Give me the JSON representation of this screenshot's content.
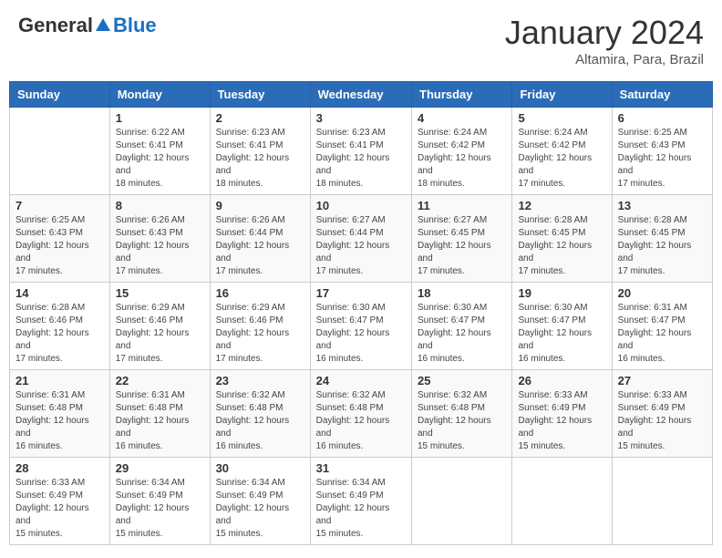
{
  "header": {
    "logo_general": "General",
    "logo_blue": "Blue",
    "month_title": "January 2024",
    "location": "Altamira, Para, Brazil"
  },
  "weekdays": [
    "Sunday",
    "Monday",
    "Tuesday",
    "Wednesday",
    "Thursday",
    "Friday",
    "Saturday"
  ],
  "weeks": [
    [
      {
        "day": "",
        "sunrise": "",
        "sunset": "",
        "daylight": ""
      },
      {
        "day": "1",
        "sunrise": "Sunrise: 6:22 AM",
        "sunset": "Sunset: 6:41 PM",
        "daylight": "Daylight: 12 hours and 18 minutes."
      },
      {
        "day": "2",
        "sunrise": "Sunrise: 6:23 AM",
        "sunset": "Sunset: 6:41 PM",
        "daylight": "Daylight: 12 hours and 18 minutes."
      },
      {
        "day": "3",
        "sunrise": "Sunrise: 6:23 AM",
        "sunset": "Sunset: 6:41 PM",
        "daylight": "Daylight: 12 hours and 18 minutes."
      },
      {
        "day": "4",
        "sunrise": "Sunrise: 6:24 AM",
        "sunset": "Sunset: 6:42 PM",
        "daylight": "Daylight: 12 hours and 18 minutes."
      },
      {
        "day": "5",
        "sunrise": "Sunrise: 6:24 AM",
        "sunset": "Sunset: 6:42 PM",
        "daylight": "Daylight: 12 hours and 17 minutes."
      },
      {
        "day": "6",
        "sunrise": "Sunrise: 6:25 AM",
        "sunset": "Sunset: 6:43 PM",
        "daylight": "Daylight: 12 hours and 17 minutes."
      }
    ],
    [
      {
        "day": "7",
        "sunrise": "Sunrise: 6:25 AM",
        "sunset": "Sunset: 6:43 PM",
        "daylight": "Daylight: 12 hours and 17 minutes."
      },
      {
        "day": "8",
        "sunrise": "Sunrise: 6:26 AM",
        "sunset": "Sunset: 6:43 PM",
        "daylight": "Daylight: 12 hours and 17 minutes."
      },
      {
        "day": "9",
        "sunrise": "Sunrise: 6:26 AM",
        "sunset": "Sunset: 6:44 PM",
        "daylight": "Daylight: 12 hours and 17 minutes."
      },
      {
        "day": "10",
        "sunrise": "Sunrise: 6:27 AM",
        "sunset": "Sunset: 6:44 PM",
        "daylight": "Daylight: 12 hours and 17 minutes."
      },
      {
        "day": "11",
        "sunrise": "Sunrise: 6:27 AM",
        "sunset": "Sunset: 6:45 PM",
        "daylight": "Daylight: 12 hours and 17 minutes."
      },
      {
        "day": "12",
        "sunrise": "Sunrise: 6:28 AM",
        "sunset": "Sunset: 6:45 PM",
        "daylight": "Daylight: 12 hours and 17 minutes."
      },
      {
        "day": "13",
        "sunrise": "Sunrise: 6:28 AM",
        "sunset": "Sunset: 6:45 PM",
        "daylight": "Daylight: 12 hours and 17 minutes."
      }
    ],
    [
      {
        "day": "14",
        "sunrise": "Sunrise: 6:28 AM",
        "sunset": "Sunset: 6:46 PM",
        "daylight": "Daylight: 12 hours and 17 minutes."
      },
      {
        "day": "15",
        "sunrise": "Sunrise: 6:29 AM",
        "sunset": "Sunset: 6:46 PM",
        "daylight": "Daylight: 12 hours and 17 minutes."
      },
      {
        "day": "16",
        "sunrise": "Sunrise: 6:29 AM",
        "sunset": "Sunset: 6:46 PM",
        "daylight": "Daylight: 12 hours and 17 minutes."
      },
      {
        "day": "17",
        "sunrise": "Sunrise: 6:30 AM",
        "sunset": "Sunset: 6:47 PM",
        "daylight": "Daylight: 12 hours and 16 minutes."
      },
      {
        "day": "18",
        "sunrise": "Sunrise: 6:30 AM",
        "sunset": "Sunset: 6:47 PM",
        "daylight": "Daylight: 12 hours and 16 minutes."
      },
      {
        "day": "19",
        "sunrise": "Sunrise: 6:30 AM",
        "sunset": "Sunset: 6:47 PM",
        "daylight": "Daylight: 12 hours and 16 minutes."
      },
      {
        "day": "20",
        "sunrise": "Sunrise: 6:31 AM",
        "sunset": "Sunset: 6:47 PM",
        "daylight": "Daylight: 12 hours and 16 minutes."
      }
    ],
    [
      {
        "day": "21",
        "sunrise": "Sunrise: 6:31 AM",
        "sunset": "Sunset: 6:48 PM",
        "daylight": "Daylight: 12 hours and 16 minutes."
      },
      {
        "day": "22",
        "sunrise": "Sunrise: 6:31 AM",
        "sunset": "Sunset: 6:48 PM",
        "daylight": "Daylight: 12 hours and 16 minutes."
      },
      {
        "day": "23",
        "sunrise": "Sunrise: 6:32 AM",
        "sunset": "Sunset: 6:48 PM",
        "daylight": "Daylight: 12 hours and 16 minutes."
      },
      {
        "day": "24",
        "sunrise": "Sunrise: 6:32 AM",
        "sunset": "Sunset: 6:48 PM",
        "daylight": "Daylight: 12 hours and 16 minutes."
      },
      {
        "day": "25",
        "sunrise": "Sunrise: 6:32 AM",
        "sunset": "Sunset: 6:48 PM",
        "daylight": "Daylight: 12 hours and 15 minutes."
      },
      {
        "day": "26",
        "sunrise": "Sunrise: 6:33 AM",
        "sunset": "Sunset: 6:49 PM",
        "daylight": "Daylight: 12 hours and 15 minutes."
      },
      {
        "day": "27",
        "sunrise": "Sunrise: 6:33 AM",
        "sunset": "Sunset: 6:49 PM",
        "daylight": "Daylight: 12 hours and 15 minutes."
      }
    ],
    [
      {
        "day": "28",
        "sunrise": "Sunrise: 6:33 AM",
        "sunset": "Sunset: 6:49 PM",
        "daylight": "Daylight: 12 hours and 15 minutes."
      },
      {
        "day": "29",
        "sunrise": "Sunrise: 6:34 AM",
        "sunset": "Sunset: 6:49 PM",
        "daylight": "Daylight: 12 hours and 15 minutes."
      },
      {
        "day": "30",
        "sunrise": "Sunrise: 6:34 AM",
        "sunset": "Sunset: 6:49 PM",
        "daylight": "Daylight: 12 hours and 15 minutes."
      },
      {
        "day": "31",
        "sunrise": "Sunrise: 6:34 AM",
        "sunset": "Sunset: 6:49 PM",
        "daylight": "Daylight: 12 hours and 15 minutes."
      },
      {
        "day": "",
        "sunrise": "",
        "sunset": "",
        "daylight": ""
      },
      {
        "day": "",
        "sunrise": "",
        "sunset": "",
        "daylight": ""
      },
      {
        "day": "",
        "sunrise": "",
        "sunset": "",
        "daylight": ""
      }
    ]
  ]
}
